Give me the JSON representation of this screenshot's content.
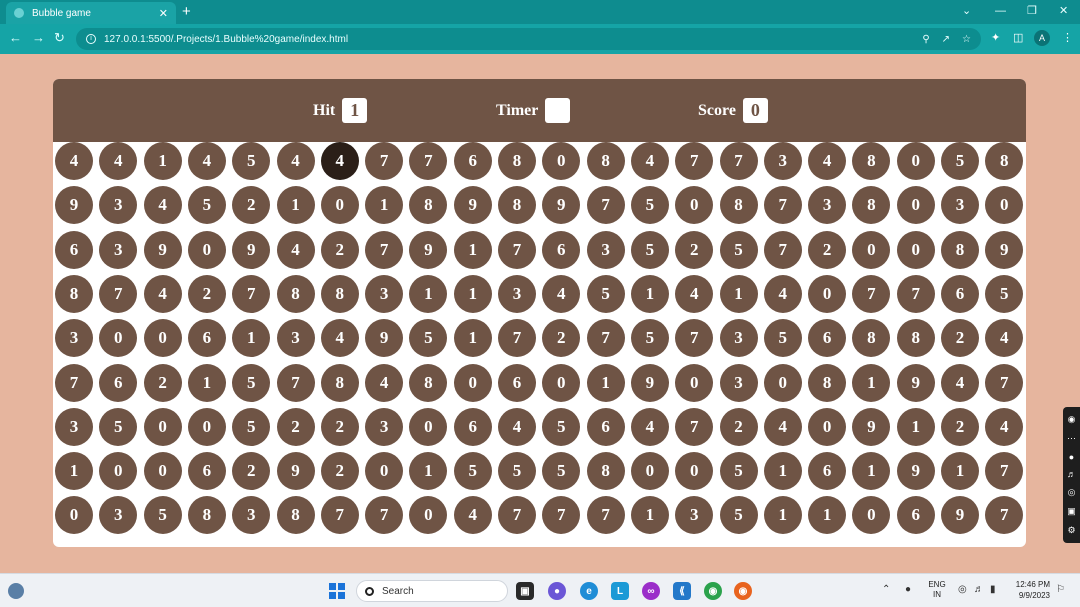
{
  "browser": {
    "tab_title": "Bubble game",
    "tab_close": "✕",
    "new_tab": "+",
    "url": "127.0.0.1:5500/.Projects/1.Bubble%20game/index.html",
    "profile_initial": "A",
    "window_controls": [
      "⌄",
      "—",
      "❐",
      "✕"
    ]
  },
  "game": {
    "hit": {
      "label": "Hit",
      "value": "1"
    },
    "timer": {
      "label": "Timer",
      "value": ""
    },
    "score": {
      "label": "Score",
      "value": "0"
    },
    "rows": [
      [
        "4",
        "4",
        "1",
        "4",
        "5",
        "4",
        "4",
        "7",
        "7",
        "6",
        "8",
        "0",
        "8",
        "4",
        "7",
        "7",
        "3",
        "4",
        "8",
        "0",
        "5",
        "8"
      ],
      [
        "9",
        "3",
        "4",
        "5",
        "2",
        "1",
        "0",
        "1",
        "8",
        "9",
        "8",
        "9",
        "7",
        "5",
        "0",
        "8",
        "7",
        "3",
        "8",
        "0",
        "3",
        "0"
      ],
      [
        "6",
        "3",
        "9",
        "0",
        "9",
        "4",
        "2",
        "7",
        "9",
        "1",
        "7",
        "6",
        "3",
        "5",
        "2",
        "5",
        "7",
        "2",
        "0",
        "0",
        "8",
        "9"
      ],
      [
        "8",
        "7",
        "4",
        "2",
        "7",
        "8",
        "8",
        "3",
        "1",
        "1",
        "3",
        "4",
        "5",
        "1",
        "4",
        "1",
        "4",
        "0",
        "7",
        "7",
        "6",
        "5"
      ],
      [
        "3",
        "0",
        "0",
        "6",
        "1",
        "3",
        "4",
        "9",
        "5",
        "1",
        "7",
        "2",
        "7",
        "5",
        "7",
        "3",
        "5",
        "6",
        "8",
        "8",
        "2",
        "4"
      ],
      [
        "7",
        "6",
        "2",
        "1",
        "5",
        "7",
        "8",
        "4",
        "8",
        "0",
        "6",
        "0",
        "1",
        "9",
        "0",
        "3",
        "0",
        "8",
        "1",
        "9",
        "4",
        "7"
      ],
      [
        "3",
        "5",
        "0",
        "0",
        "5",
        "2",
        "2",
        "3",
        "0",
        "6",
        "4",
        "5",
        "6",
        "4",
        "7",
        "2",
        "4",
        "0",
        "9",
        "1",
        "2",
        "4"
      ],
      [
        "1",
        "0",
        "0",
        "6",
        "2",
        "9",
        "2",
        "0",
        "1",
        "5",
        "5",
        "5",
        "8",
        "0",
        "0",
        "5",
        "1",
        "6",
        "1",
        "9",
        "1",
        "7"
      ],
      [
        "0",
        "3",
        "5",
        "8",
        "3",
        "8",
        "7",
        "7",
        "0",
        "4",
        "7",
        "7",
        "7",
        "1",
        "3",
        "5",
        "1",
        "1",
        "0",
        "6",
        "9",
        "7"
      ]
    ],
    "hovered": {
      "row": 0,
      "col": 6
    },
    "colors": {
      "bubble": "#6f5445",
      "bubble_hover": "#2b1f18",
      "header": "#6f5445",
      "page_bg": "#e6b59e"
    }
  },
  "taskbar": {
    "search_placeholder": "Search",
    "lang_top": "ENG",
    "lang_bottom": "IN",
    "time": "12:46 PM",
    "date": "9/9/2023"
  }
}
